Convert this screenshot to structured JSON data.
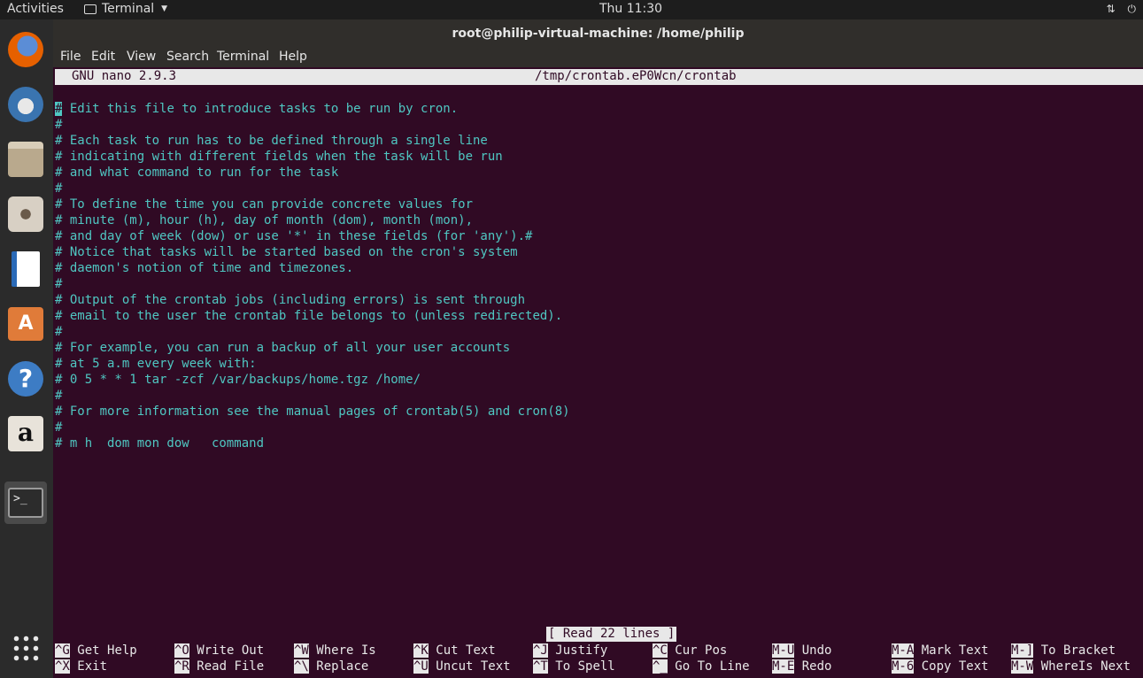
{
  "topbar": {
    "activities": "Activities",
    "app_name": "Terminal",
    "clock": "Thu 11:30"
  },
  "dock": {
    "items": [
      {
        "name": "firefox-icon",
        "color": "#e66000"
      },
      {
        "name": "thunderbird-icon",
        "color": "#3a74b0"
      },
      {
        "name": "files-icon",
        "color": "#b9a98d"
      },
      {
        "name": "rhythmbox-icon",
        "color": "#d8d0c4"
      },
      {
        "name": "writer-icon",
        "color": "#2a6ab7"
      },
      {
        "name": "software-center-icon",
        "color": "#e07b39"
      },
      {
        "name": "help-icon",
        "color": "#3d7cc4"
      },
      {
        "name": "amazon-icon",
        "color": "#e8e3da"
      },
      {
        "name": "terminal-icon",
        "color": "#2c2c2c"
      }
    ]
  },
  "window": {
    "title": "root@philip-virtual-machine: /home/philip",
    "menu": [
      "File",
      "Edit",
      "View",
      "Search",
      "Terminal",
      "Help"
    ]
  },
  "nano": {
    "version": "GNU nano 2.9.3",
    "filename": "/tmp/crontab.eP0Wcn/crontab",
    "first_line_rest": " Edit this file to introduce tasks to be run by cron.",
    "lines": [
      "#",
      "# Each task to run has to be defined through a single line",
      "# indicating with different fields when the task will be run",
      "# and what command to run for the task",
      "#",
      "# To define the time you can provide concrete values for",
      "# minute (m), hour (h), day of month (dom), month (mon),",
      "# and day of week (dow) or use '*' in these fields (for 'any').#",
      "# Notice that tasks will be started based on the cron's system",
      "# daemon's notion of time and timezones.",
      "#",
      "# Output of the crontab jobs (including errors) is sent through",
      "# email to the user the crontab file belongs to (unless redirected).",
      "#",
      "# For example, you can run a backup of all your user accounts",
      "# at 5 a.m every week with:",
      "# 0 5 * * 1 tar -zcf /var/backups/home.tgz /home/",
      "#",
      "# For more information see the manual pages of crontab(5) and cron(8)",
      "#",
      "# m h  dom mon dow   command"
    ],
    "status": "[ Read 22 lines ]",
    "shortcuts_row1": [
      {
        "key": "^G",
        "label": "Get Help"
      },
      {
        "key": "^O",
        "label": "Write Out"
      },
      {
        "key": "^W",
        "label": "Where Is"
      },
      {
        "key": "^K",
        "label": "Cut Text"
      },
      {
        "key": "^J",
        "label": "Justify"
      },
      {
        "key": "^C",
        "label": "Cur Pos"
      },
      {
        "key": "M-U",
        "label": "Undo"
      },
      {
        "key": "M-A",
        "label": "Mark Text"
      },
      {
        "key": "M-]",
        "label": "To Bracket"
      }
    ],
    "shortcuts_row2": [
      {
        "key": "^X",
        "label": "Exit"
      },
      {
        "key": "^R",
        "label": "Read File"
      },
      {
        "key": "^\\",
        "label": "Replace"
      },
      {
        "key": "^U",
        "label": "Uncut Text"
      },
      {
        "key": "^T",
        "label": "To Spell"
      },
      {
        "key": "^_",
        "label": "Go To Line"
      },
      {
        "key": "M-E",
        "label": "Redo"
      },
      {
        "key": "M-6",
        "label": "Copy Text"
      },
      {
        "key": "M-W",
        "label": "WhereIs Next"
      }
    ]
  }
}
